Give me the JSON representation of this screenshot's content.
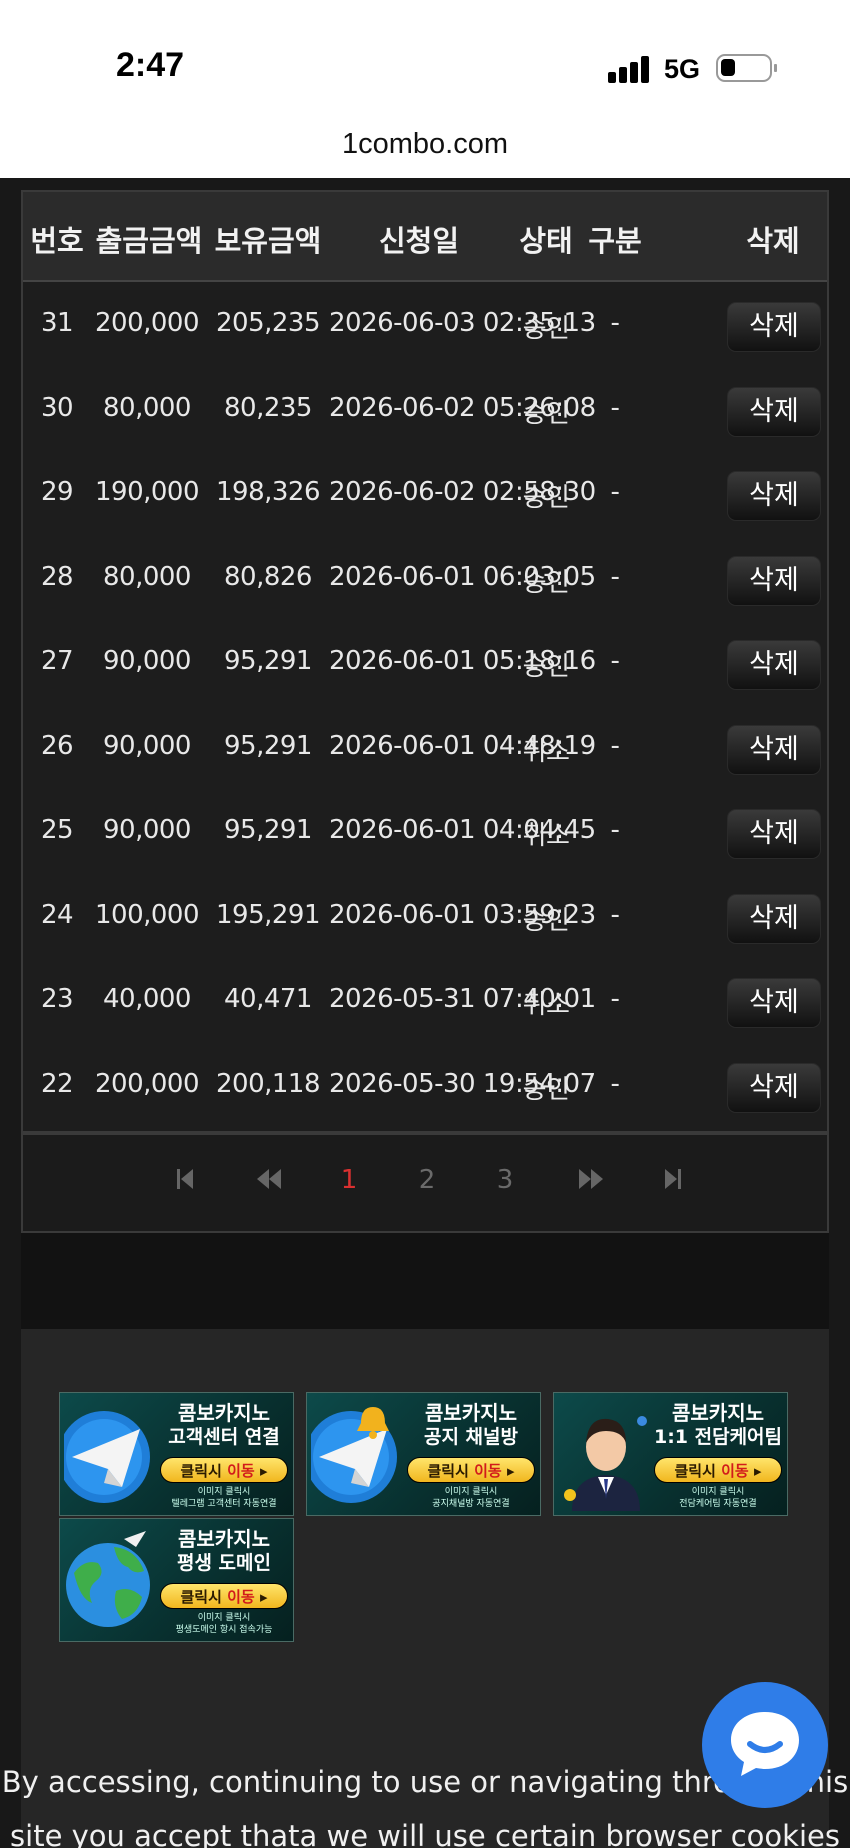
{
  "status_bar": {
    "time": "2:47",
    "network": "5G"
  },
  "browser": {
    "url": "1combo.com"
  },
  "table": {
    "headers": {
      "no": "번호",
      "withdraw_amount": "출금금액",
      "balance": "보유금액",
      "request_date": "신청일",
      "status": "상태",
      "category": "구분",
      "delete": "삭제"
    },
    "rows": [
      {
        "no": "31",
        "amount": "200,000",
        "balance": "205,235",
        "date": "2026-06-03 02:35:13",
        "status": "승인",
        "category": "-",
        "action": "삭제"
      },
      {
        "no": "30",
        "amount": "80,000",
        "balance": "80,235",
        "date": "2026-06-02 05:26:08",
        "status": "승인",
        "category": "-",
        "action": "삭제"
      },
      {
        "no": "29",
        "amount": "190,000",
        "balance": "198,326",
        "date": "2026-06-02 02:58:30",
        "status": "승인",
        "category": "-",
        "action": "삭제"
      },
      {
        "no": "28",
        "amount": "80,000",
        "balance": "80,826",
        "date": "2026-06-01 06:03:05",
        "status": "승인",
        "category": "-",
        "action": "삭제"
      },
      {
        "no": "27",
        "amount": "90,000",
        "balance": "95,291",
        "date": "2026-06-01 05:18:16",
        "status": "승인",
        "category": "-",
        "action": "삭제"
      },
      {
        "no": "26",
        "amount": "90,000",
        "balance": "95,291",
        "date": "2026-06-01 04:48:19",
        "status": "취소",
        "category": "-",
        "action": "삭제"
      },
      {
        "no": "25",
        "amount": "90,000",
        "balance": "95,291",
        "date": "2026-06-01 04:04:45",
        "status": "취소",
        "category": "-",
        "action": "삭제"
      },
      {
        "no": "24",
        "amount": "100,000",
        "balance": "195,291",
        "date": "2026-06-01 03:59:23",
        "status": "승인",
        "category": "-",
        "action": "삭제"
      },
      {
        "no": "23",
        "amount": "40,000",
        "balance": "40,471",
        "date": "2026-05-31 07:40:01",
        "status": "취소",
        "category": "-",
        "action": "삭제"
      },
      {
        "no": "22",
        "amount": "200,000",
        "balance": "200,118",
        "date": "2026-05-30 19:54:07",
        "status": "승인",
        "category": "-",
        "action": "삭제"
      }
    ]
  },
  "pagination": {
    "pages": [
      "1",
      "2",
      "3"
    ],
    "current": "1",
    "active_color": "#d93030"
  },
  "banners": [
    {
      "title": "콤보카지노",
      "subtitle": "고객센터 연결",
      "cta_prefix": "클릭시 ",
      "cta_highlight": "이동",
      "small1": "이미지 클릭시",
      "small2": "텔레그램 고객센터 자동연결",
      "icon": "telegram-icon"
    },
    {
      "title": "콤보카지노",
      "subtitle": "공지 채널방",
      "cta_prefix": "클릭시 ",
      "cta_highlight": "이동",
      "small1": "이미지 클릭시",
      "small2": "공지채널방 자동연결",
      "icon": "telegram-bell-icon"
    },
    {
      "title": "콤보카지노",
      "subtitle": "1:1 전담케어팀",
      "cta_prefix": "클릭시 ",
      "cta_highlight": "이동",
      "small1": "이미지 클릭시",
      "small2": "전담케어팀 자동연결",
      "icon": "agent-avatar-icon"
    },
    {
      "title": "콤보카지노",
      "subtitle": "평생 도메인",
      "cta_prefix": "클릭시 ",
      "cta_highlight": "이동",
      "small1": "이미지 클릭시",
      "small2": "평생도메인 항시 접속가능",
      "icon": "globe-icon"
    }
  ],
  "cookie_notice": {
    "line1": "By accessing, continuing to use or navigating through this",
    "line2": "site you accept thata we will use certain browser cookies to"
  },
  "chat_button": {
    "icon": "chat-bubble-icon",
    "color": "#2f7de8"
  }
}
